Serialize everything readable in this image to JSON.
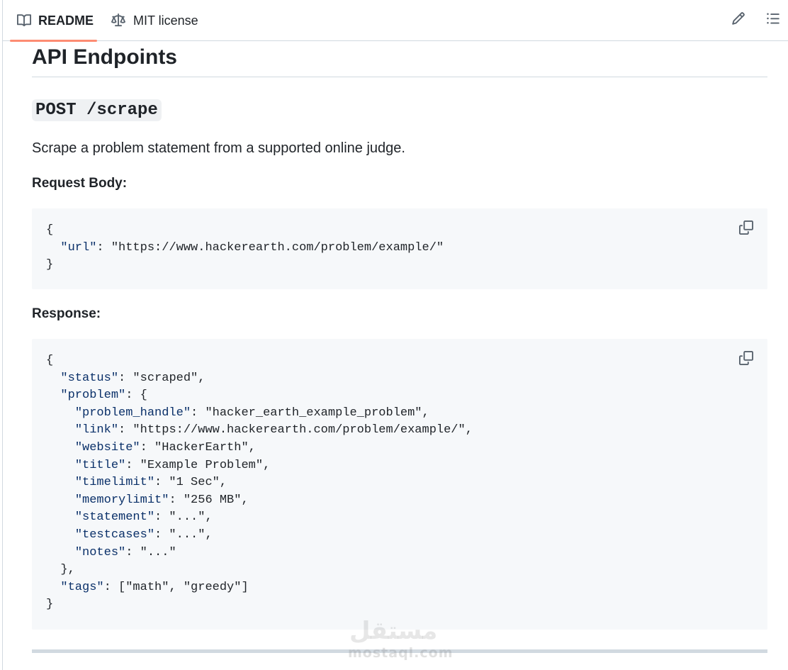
{
  "tabs": {
    "readme": "README",
    "license": "MIT license"
  },
  "section": {
    "title": "API Endpoints",
    "endpoint": "POST /scrape",
    "description": "Scrape a problem statement from a supported online judge.",
    "request_label": "Request Body:",
    "response_label": "Response:"
  },
  "request_code": {
    "l1": "{",
    "l2_key": "\"url\"",
    "l2_val": ": \"https://www.hackerearth.com/problem/example/\"",
    "l3": "}"
  },
  "response_code": {
    "open": "{",
    "status_key": "\"status\"",
    "status_val": ": \"scraped\",",
    "problem_key": "\"problem\"",
    "problem_val": ": {",
    "handle_key": "\"problem_handle\"",
    "handle_val": ": \"hacker_earth_example_problem\",",
    "link_key": "\"link\"",
    "link_val": ": \"https://www.hackerearth.com/problem/example/\",",
    "website_key": "\"website\"",
    "website_val": ": \"HackerEarth\",",
    "title_key": "\"title\"",
    "title_val": ": \"Example Problem\",",
    "timelimit_key": "\"timelimit\"",
    "timelimit_val": ": \"1 Sec\",",
    "memorylimit_key": "\"memorylimit\"",
    "memorylimit_val": ": \"256 MB\",",
    "statement_key": "\"statement\"",
    "statement_val": ": \"...\",",
    "testcases_key": "\"testcases\"",
    "testcases_val": ": \"...\",",
    "notes_key": "\"notes\"",
    "notes_val": ": \"...\"",
    "problem_close": "},",
    "tags_key": "\"tags\"",
    "tags_val": ": [\"math\", \"greedy\"]",
    "close": "}"
  },
  "watermark": {
    "logo": "مستقل",
    "domain": "mostaql.com"
  },
  "icons": {
    "readme": "book-icon",
    "license": "law-icon",
    "edit": "pencil-icon",
    "outline": "list-unordered-icon",
    "copy": "copy-icon"
  },
  "colors": {
    "active_tab_underline": "#fd8c73",
    "code_background": "#f6f8fa",
    "json_key": "#0a3069"
  }
}
